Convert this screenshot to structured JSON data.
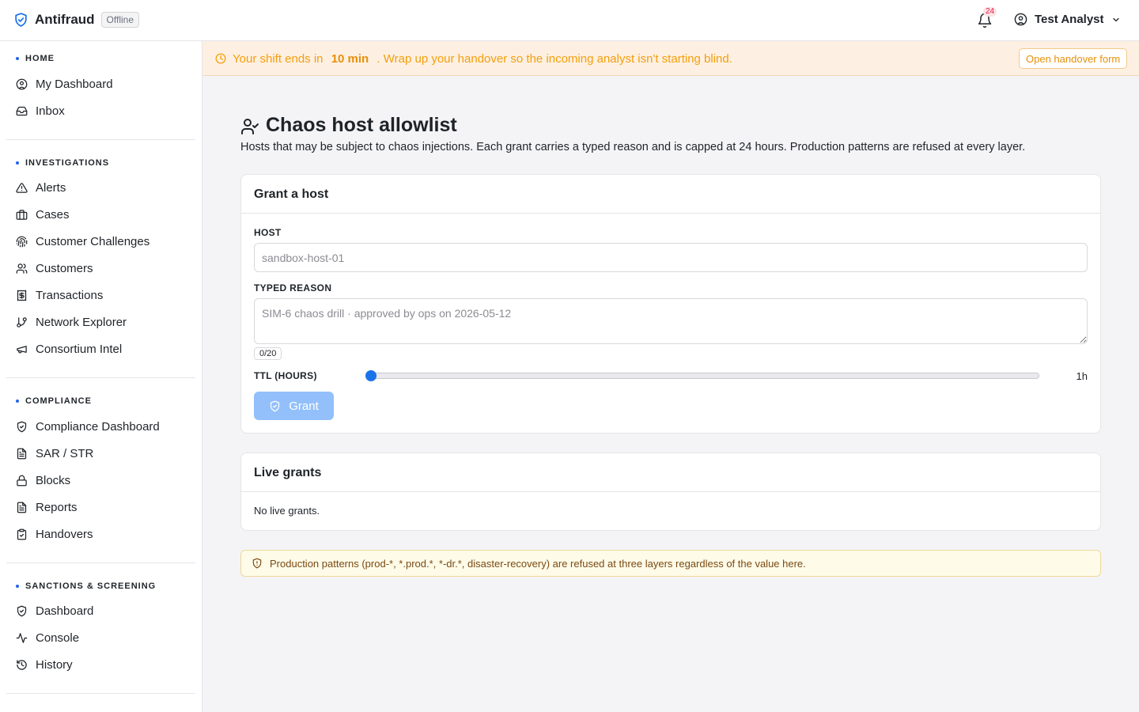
{
  "app": {
    "name": "Antifraud",
    "status_badge": "Offline"
  },
  "header": {
    "notification_count": "24",
    "user_name": "Test Analyst"
  },
  "sidebar": {
    "sections": [
      {
        "title": "HOME",
        "items": [
          "My Dashboard",
          "Inbox"
        ]
      },
      {
        "title": "INVESTIGATIONS",
        "items": [
          "Alerts",
          "Cases",
          "Customer Challenges",
          "Customers",
          "Transactions",
          "Network Explorer",
          "Consortium Intel"
        ]
      },
      {
        "title": "COMPLIANCE",
        "items": [
          "Compliance Dashboard",
          "SAR / STR",
          "Blocks",
          "Reports",
          "Handovers"
        ]
      },
      {
        "title": "SANCTIONS & SCREENING",
        "items": [
          "Dashboard",
          "Console",
          "History"
        ]
      }
    ]
  },
  "banner": {
    "prefix": "Your shift ends in",
    "time": "10 min",
    "suffix": ". Wrap up your handover so the incoming analyst isn't starting blind.",
    "button_label": "Open handover form"
  },
  "page": {
    "title": "Chaos host allowlist",
    "subtitle": "Hosts that may be subject to chaos injections. Each grant carries a typed reason and is capped at 24 hours. Production patterns are refused at every layer."
  },
  "grant_card": {
    "title": "Grant a host",
    "host_label": "HOST",
    "host_placeholder": "sandbox-host-01",
    "host_value": "",
    "reason_label": "TYPED REASON",
    "reason_placeholder": "SIM-6 chaos drill · approved by ops on 2026-05-12",
    "reason_value": "",
    "char_counter": "0/20",
    "ttl_label": "TTL (HOURS)",
    "ttl_value": "1h",
    "ttl_fraction": 0,
    "grant_button": "Grant"
  },
  "live_card": {
    "title": "Live grants",
    "empty_text": "No live grants."
  },
  "warning": {
    "text": "Production patterns (prod-*, *.prod.*, *-dr.*, disaster-recovery) are refused at three layers regardless of the value here."
  },
  "colors": {
    "accent": "#2563eb",
    "banner_bg": "#fdf0e2",
    "banner_text": "#f59e0b",
    "grant_button_disabled": "#93c0fb",
    "warning_bg": "#fefbe8"
  }
}
